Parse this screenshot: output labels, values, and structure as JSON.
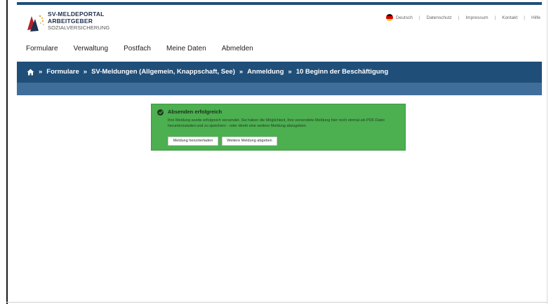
{
  "logo": {
    "line1": "SV-MELDEPORTAL",
    "line2": "ARBEITGEBER",
    "line3": "SOZIALVERSICHERUNG"
  },
  "meta_nav": {
    "language": "Deutsch",
    "items": [
      "Datenschutz",
      "Impressum",
      "Kontakt",
      "Hilfe"
    ]
  },
  "main_nav": {
    "items": [
      "Formulare",
      "Verwaltung",
      "Postfach",
      "Meine Daten",
      "Abmelden"
    ]
  },
  "breadcrumb": {
    "items": [
      "Formulare",
      "SV-Meldungen (Allgemein, Knappschaft, See)",
      "Anmeldung",
      "10 Beginn der Beschäftigung"
    ],
    "separator": "»"
  },
  "alert": {
    "title": "Absenden erfolgreich",
    "body": "Ihre Meldung wurde erfolgreich versendet. Sie haben die Möglichkeit, Ihre versendete Meldung hier noch einmal als PDF-Datei herunterzuladen und zu speichern - oder direkt eine weitere Meldung abzugeben.",
    "download_label": "Meldung herunterladen",
    "new_label": "Weitere Meldung abgeben"
  },
  "colors": {
    "brand_blue": "#1f4e79",
    "band_lower": "#3f6e9a",
    "success_green": "#4caf50"
  },
  "icons": {
    "home": "home-icon",
    "check": "check-circle-icon",
    "flag": "german-flag-icon"
  }
}
